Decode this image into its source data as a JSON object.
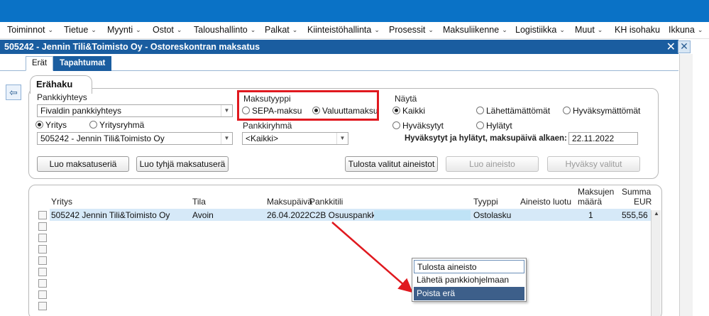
{
  "menu": [
    {
      "label": "Toiminnot",
      "chev": true
    },
    {
      "label": "Tietue",
      "chev": true
    },
    {
      "label": "Myynti",
      "chev": true
    },
    {
      "label": "Ostot",
      "chev": true
    },
    {
      "label": "Taloushallinto",
      "chev": true
    },
    {
      "label": "Palkat",
      "chev": true
    },
    {
      "label": "Kiinteistöhallinta",
      "chev": true
    },
    {
      "label": "Prosessit",
      "chev": true
    },
    {
      "label": "Maksuliikenne",
      "chev": true
    },
    {
      "label": "Logistiikka",
      "chev": true
    },
    {
      "label": "Muut",
      "chev": true
    },
    {
      "label": "KH isohaku",
      "chev": false
    },
    {
      "label": "Ikkuna",
      "chev": true
    }
  ],
  "window": {
    "title": "505242 - Jennin Tili&Toimisto Oy - Ostoreskontran maksatus",
    "close": "✕"
  },
  "tabs": {
    "eras": "Erät",
    "events": "Tapahtumat"
  },
  "search": {
    "heading": "Erähaku",
    "bank_label": "Pankkiyhteys",
    "bank_value": "Fivaldin pankkiyhteys",
    "payment_type_label": "Maksutyyppi",
    "sepa": "SEPA-maksu",
    "currency": "Valuuttamaksu",
    "company_radio": "Yritys",
    "company_group_radio": "Yritysryhmä",
    "company_value": "505242 - Jennin Tili&Toimisto Oy",
    "bank_group_label": "Pankkiryhmä",
    "bank_group_value": "<Kaikki>",
    "show_label": "Näytä",
    "all": "Kaikki",
    "unsent": "Lähettämättömät",
    "unapproved": "Hyväksymättömät",
    "approved": "Hyväksytyt",
    "rejected": "Hylätyt",
    "date_label": "Hyväksytyt ja hylätyt, maksupäivä  alkaen:",
    "date_value": "22.11.2022"
  },
  "buttons": {
    "create": "Luo maksatuseriä",
    "create_empty": "Luo tyhjä maksatuserä",
    "print_selected": "Tulosta valitut aineistot",
    "create_material": "Luo aineisto",
    "approve_selected": "Hyväksy valitut"
  },
  "grid": {
    "headers": {
      "company": "Yritys",
      "status": "Tila",
      "pay_date": "Maksupäivä",
      "bank_account": "Pankkitili",
      "type": "Tyyppi",
      "material_created": "Aineisto luotu",
      "count_1": "Maksujen",
      "count_2": "määrä",
      "sum_1": "Summa",
      "sum_2": "EUR"
    },
    "row": {
      "company": "505242 Jennin Tili&Toimisto Oy",
      "status": "Avoin",
      "pay_date": "26.04.2022",
      "bank_account": "C2B Osuuspankki",
      "type": "Ostolasku",
      "count": "1",
      "sum": "555,56"
    }
  },
  "context_menu": [
    "Tulosta aineisto",
    "Lähetä pankkiohjelmaan",
    "Poista erä"
  ],
  "colors": {
    "accent": "#0a72c6",
    "title": "#1a5da0",
    "highlight": "#e0191f"
  }
}
